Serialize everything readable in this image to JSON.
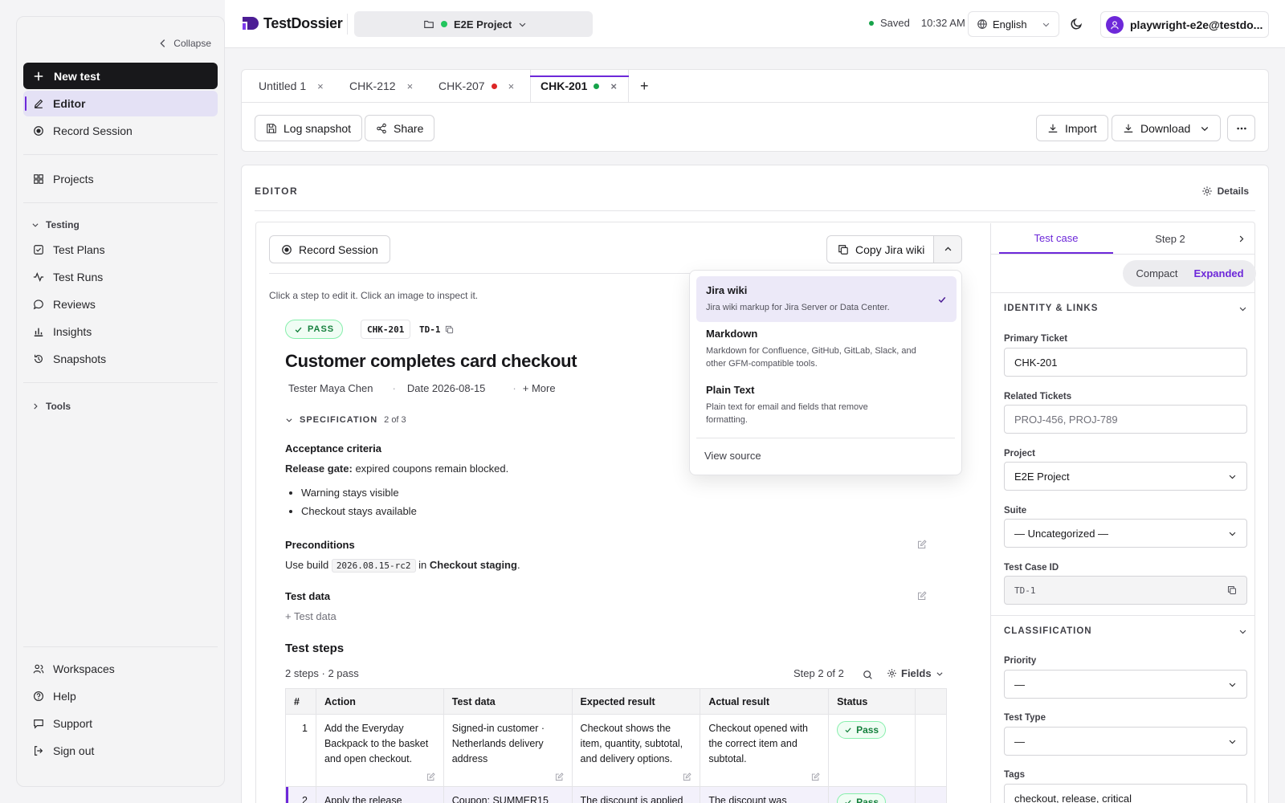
{
  "sidebar": {
    "collapse": "Collapse",
    "new_test": "New test",
    "editor": "Editor",
    "record_session": "Record Session",
    "projects": "Projects",
    "testing_group": "Testing",
    "test_plans": "Test Plans",
    "test_runs": "Test Runs",
    "reviews": "Reviews",
    "insights": "Insights",
    "snapshots": "Snapshots",
    "tools_group": "Tools",
    "workspaces": "Workspaces",
    "help": "Help",
    "support": "Support",
    "sign_out": "Sign out"
  },
  "header": {
    "brand": "TestDossier",
    "project": "E2E Project",
    "saved": "Saved",
    "time": "10:32 AM",
    "language": "English",
    "user": "playwright-e2e@testdo..."
  },
  "tabs": [
    {
      "label": "Untitled 1"
    },
    {
      "label": "CHK-212"
    },
    {
      "label": "CHK-207"
    },
    {
      "label": "CHK-201"
    }
  ],
  "toolbar": {
    "log_snapshot": "Log snapshot",
    "share": "Share",
    "import": "Import",
    "download": "Download"
  },
  "editor": {
    "label": "EDITOR",
    "details": "Details",
    "record_session": "Record Session",
    "copy": "Copy Jira wiki",
    "hint": "Click a step to edit it. Click an image to inspect it.",
    "status": "PASS",
    "key": "CHK-201",
    "id": "TD-1",
    "title": "Customer completes card checkout",
    "tester": "Tester Maya Chen",
    "date": "Date 2026-08-15",
    "more": "+ More",
    "spec_label": "SPECIFICATION",
    "spec_count": "2 of 3",
    "acceptance_title": "Acceptance criteria",
    "release_gate_label": "Release gate:",
    "release_gate_text": " expired coupons remain blocked.",
    "bullets": [
      "Warning stays visible",
      "Checkout stays available"
    ],
    "preconditions_title": "Preconditions",
    "pre_text1": "Use build ",
    "pre_build": "2026.08.15-rc2",
    "pre_text2": " in ",
    "pre_env": "Checkout staging",
    "pre_text3": ".",
    "testdata_title": "Test data",
    "add_testdata": "+ Test data",
    "steps_title": "Test steps",
    "steps_summary": "2 steps · 2 pass",
    "step_nav": "Step 2 of 2",
    "fields": "Fields"
  },
  "dropdown": {
    "options": [
      {
        "title": "Jira wiki",
        "desc": "Jira wiki markup for Jira Server or Data Center."
      },
      {
        "title": "Markdown",
        "desc": "Markdown for Confluence, GitHub, GitLab, Slack, and other GFM-compatible tools."
      },
      {
        "title": "Plain Text",
        "desc": "Plain text for email and fields that remove formatting."
      }
    ],
    "view_source": "View source"
  },
  "table": {
    "headers": [
      "#",
      "Action",
      "Test data",
      "Expected result",
      "Actual result",
      "Status"
    ],
    "rows": [
      {
        "num": "1",
        "action": "Add the Everyday Backpack to the basket and open checkout.",
        "data": "Signed-in customer · Netherlands delivery address",
        "expected": "Checkout shows the item, quantity, subtotal, and delivery options.",
        "actual": "Checkout opened with the correct item and subtotal.",
        "status": "Pass"
      },
      {
        "num": "2",
        "action": "Apply the release",
        "data": "Coupon: SUMMER15",
        "expected": "The discount is applied",
        "actual": "The discount was",
        "status": "Pass"
      }
    ]
  },
  "right_panel": {
    "tab_test_case": "Test case",
    "tab_step2": "Step 2",
    "compact": "Compact",
    "expanded": "Expanded",
    "identity": "IDENTITY & LINKS",
    "primary_ticket_label": "Primary Ticket",
    "primary_ticket": "CHK-201",
    "related_label": "Related Tickets",
    "related_placeholder": "PROJ-456, PROJ-789",
    "project_label": "Project",
    "project": "E2E Project",
    "suite_label": "Suite",
    "suite": "— Uncategorized —",
    "tcid_label": "Test Case ID",
    "tcid": "TD-1",
    "classification": "CLASSIFICATION",
    "priority_label": "Priority",
    "priority": "—",
    "type_label": "Test Type",
    "type": "—",
    "tags_label": "Tags",
    "tags": "checkout, release, critical"
  },
  "colors": {
    "accent": "#6d28d9",
    "pass": "#15803d",
    "unsaved_dot": "#dc2626",
    "saved_dot": "#16a34a",
    "project_dot": "#22c55e"
  }
}
